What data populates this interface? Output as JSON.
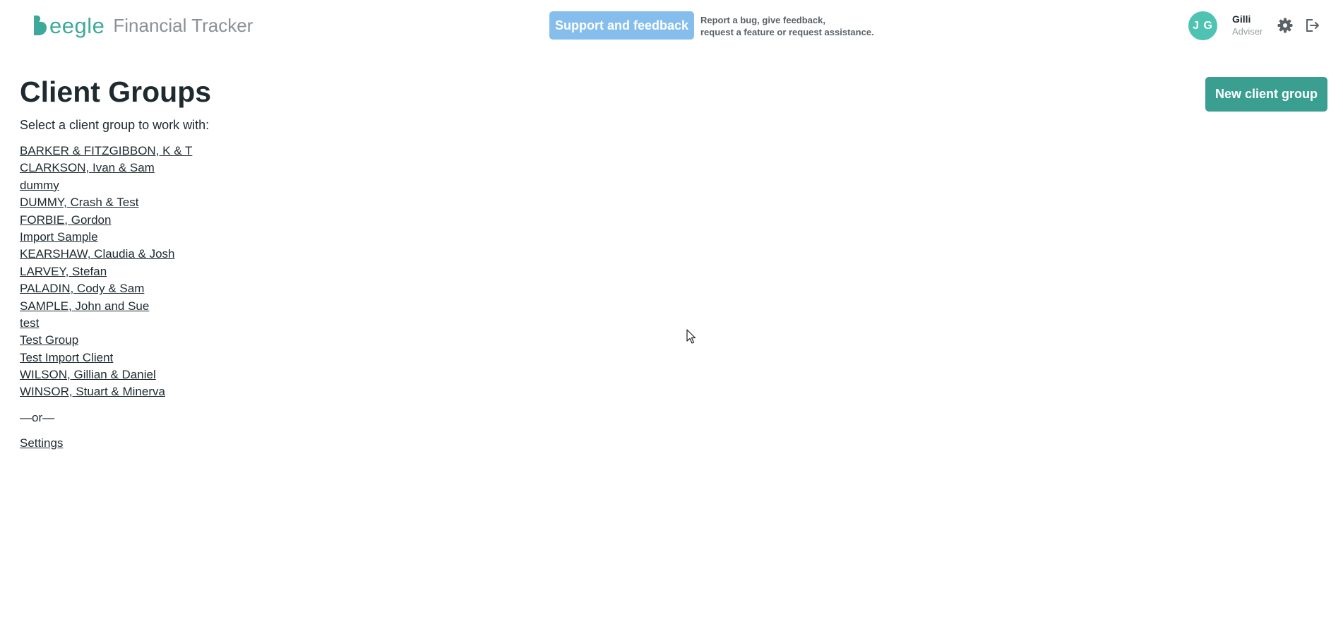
{
  "header": {
    "logo_text": "eegle",
    "app_name": "Financial Tracker",
    "support_button": "Support and feedback",
    "support_note_line1": "Report a bug, give feedback,",
    "support_note_line2": "request a feature or request assistance.",
    "user_initials": "J G",
    "user_name": "Gilli",
    "user_role": "Adviser",
    "icons": [
      "logo-mark-icon",
      "gear-icon",
      "logout-icon"
    ]
  },
  "colors": {
    "brand": "#3ea89a",
    "support_button": "#85bdec",
    "primary_button": "#3a9f91",
    "avatar": "#4fc3b2"
  },
  "main": {
    "title": "Client Groups",
    "subtitle": "Select a client group to work with:",
    "new_group_button": "New client group",
    "groups": [
      "BARKER & FITZGIBBON, K & T",
      "CLARKSON, Ivan & Sam",
      "dummy",
      "DUMMY, Crash & Test",
      "FORBIE, Gordon",
      "Import Sample",
      "KEARSHAW, Claudia & Josh",
      "LARVEY, Stefan",
      "PALADIN, Cody & Sam",
      "SAMPLE, John and Sue",
      "test",
      "Test Group",
      "Test Import Client",
      "WILSON, Gillian & Daniel",
      "WINSOR, Stuart & Minerva"
    ],
    "separator": "—or—",
    "settings_link": "Settings"
  }
}
